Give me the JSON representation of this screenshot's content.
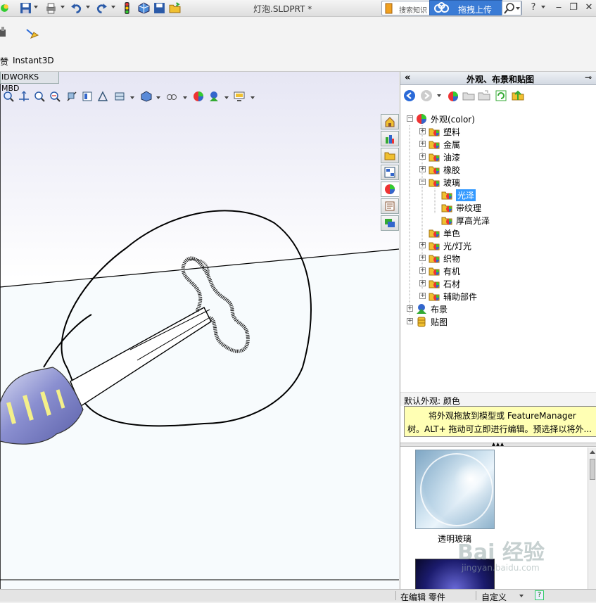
{
  "window": {
    "doc_title": "灯泡.SLDPRT *",
    "search_placeholder": "搜索知识",
    "baidu_upload": "拖拽上传"
  },
  "command_manager": {
    "cut_label": "赞",
    "instant3d_label": "Instant3D"
  },
  "viewport": {
    "tab_label": "IDWORKS MBD"
  },
  "task_pane": {
    "title": "外观、布景和贴图",
    "collapse": "«",
    "tree": {
      "root": "外观(color)",
      "items": [
        {
          "label": "塑料",
          "expander": "+"
        },
        {
          "label": "金属",
          "expander": "+"
        },
        {
          "label": "油漆",
          "expander": "+"
        },
        {
          "label": "橡胶",
          "expander": "+"
        },
        {
          "label": "玻璃",
          "expander": "−"
        },
        {
          "label": "光泽",
          "child": true,
          "selected": true
        },
        {
          "label": "带纹理",
          "child": true
        },
        {
          "label": "厚高光泽",
          "child": true
        },
        {
          "label": "单色",
          "expander": ""
        },
        {
          "label": "光/灯光",
          "expander": "+"
        },
        {
          "label": "织物",
          "expander": "+"
        },
        {
          "label": "有机",
          "expander": "+"
        },
        {
          "label": "石材",
          "expander": "+"
        },
        {
          "label": "辅助部件",
          "expander": "+"
        }
      ],
      "scenes": "布景",
      "decals": "贴图"
    },
    "default_appearance": "默认外观: 颜色",
    "tooltip_line1": "将外观拖放到模型或 FeatureManager",
    "tooltip_line2": "树。ALT+ 拖动可立即进行编辑。预选择以将外...",
    "swatch_label": "透明玻璃"
  },
  "status_bar": {
    "editing": "在编辑 零件",
    "units": "自定义",
    "help": "?"
  },
  "watermark": {
    "brand": "Bai 经验",
    "url": "jingyan.baidu.com"
  },
  "colors": {
    "selection": "#3399ff",
    "tooltip_bg": "#ffffb4",
    "folder": "#f0c030"
  }
}
